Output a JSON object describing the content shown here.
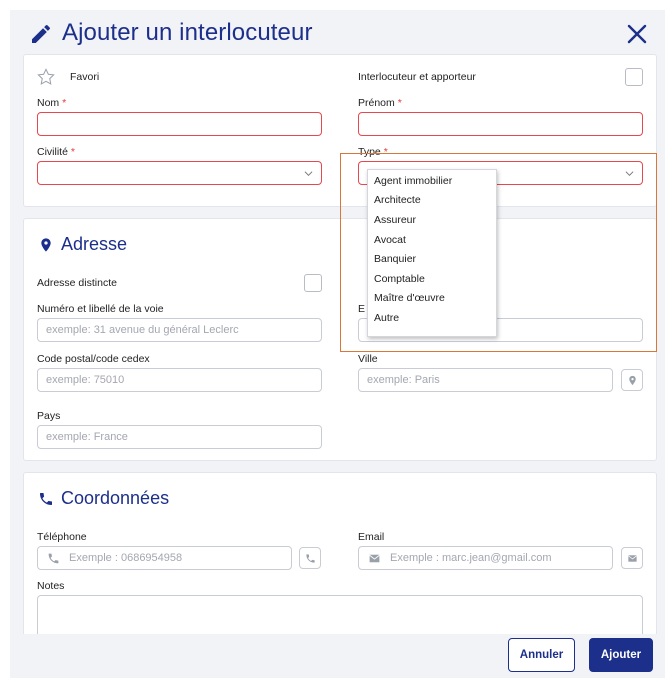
{
  "header": {
    "title": "Ajouter un interlocuteur"
  },
  "identity": {
    "favori_label": "Favori",
    "interlocuteur_label": "Interlocuteur et apporteur",
    "nom_label": "Nom",
    "prenom_label": "Prénom",
    "civilite_label": "Civilité",
    "type_label": "Type",
    "required_mark": "*"
  },
  "type_options": [
    "Agent immobilier",
    "Architecte",
    "Assureur",
    "Avocat",
    "Banquier",
    "Comptable",
    "Maître d'œuvre",
    "Autre"
  ],
  "address": {
    "title": "Adresse",
    "distinct_label": "Adresse distincte",
    "street_label": "Numéro et libellé de la voie",
    "street_placeholder": "exemple: 31 avenue du général Leclerc",
    "complement_label_partial": "E",
    "postal_label": "Code postal/code cedex",
    "postal_placeholder": "exemple: 75010",
    "city_label": "Ville",
    "city_placeholder": "exemple: Paris",
    "country_label": "Pays",
    "country_placeholder": "exemple: France"
  },
  "contact": {
    "title": "Coordonnées",
    "phone_label": "Téléphone",
    "phone_placeholder": "Exemple : 0686954958",
    "email_label": "Email",
    "email_placeholder": "Exemple : marc.jean@gmail.com",
    "notes_label": "Notes"
  },
  "footer": {
    "cancel_label": "Annuler",
    "add_label": "Ajouter"
  },
  "colors": {
    "primary": "#1c2f8a",
    "error": "#e5484d",
    "highlight": "#d9773a"
  }
}
